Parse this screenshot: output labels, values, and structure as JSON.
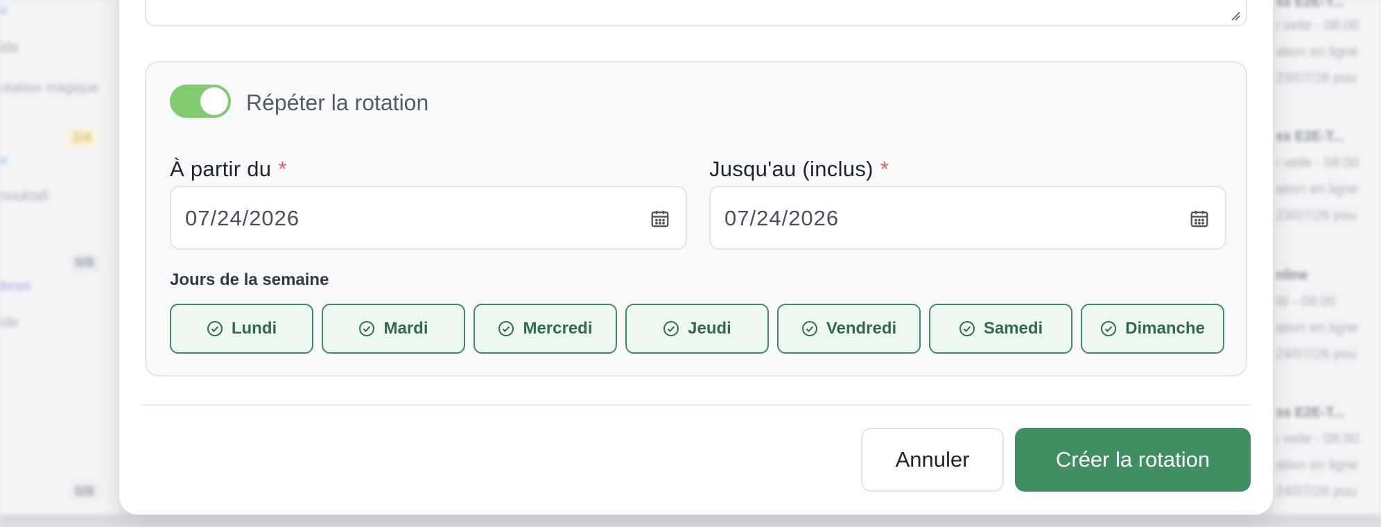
{
  "background": {
    "left_items": [
      {
        "text": "v"
      },
      {
        "text": "ide"
      },
      {
        "text": "otation magique"
      },
      {
        "text": "2/4"
      },
      {
        "text": "v"
      },
      {
        "text": "nouktafi"
      },
      {
        "text": "0/8"
      },
      {
        "text": "bron"
      },
      {
        "text": "ide"
      },
      {
        "text": "0/8"
      }
    ],
    "right_items": [
      {
        "text": "ss E2E-T..."
      },
      {
        "text": "ı veile - 08:00"
      },
      {
        "text": "ation en ligne"
      },
      {
        "text": "23/07/26 pou"
      },
      {
        "text": "ss E2E-T..."
      },
      {
        "text": "ı veile - 08:00"
      },
      {
        "text": "ation en ligne"
      },
      {
        "text": "23/07/26 pou"
      },
      {
        "text": "nline"
      },
      {
        "text": "W - 08:00"
      },
      {
        "text": "ation en ligne"
      },
      {
        "text": "24/07/26 pou"
      },
      {
        "text": "ss E2E-T..."
      },
      {
        "text": "ı veile - 08:00"
      },
      {
        "text": "ation en ligne"
      },
      {
        "text": "24/07/26 pou"
      }
    ]
  },
  "repeat": {
    "enabled": true,
    "label": "Répéter la rotation",
    "from": {
      "label": "À partir du",
      "required_mark": "*",
      "value": "07/24/2026"
    },
    "until": {
      "label": "Jusqu'au (inclus)",
      "required_mark": "*",
      "value": "07/24/2026"
    },
    "days_label": "Jours de la semaine",
    "days": [
      {
        "label": "Lundi",
        "selected": true
      },
      {
        "label": "Mardi",
        "selected": true
      },
      {
        "label": "Mercredi",
        "selected": true
      },
      {
        "label": "Jeudi",
        "selected": true
      },
      {
        "label": "Vendredi",
        "selected": true
      },
      {
        "label": "Samedi",
        "selected": true
      },
      {
        "label": "Dimanche",
        "selected": true
      }
    ]
  },
  "actions": {
    "cancel_label": "Annuler",
    "create_label": "Créer la rotation"
  },
  "icons": {
    "calendar": "calendar-icon",
    "check": "check-circle-icon",
    "resize": "resize-handle-icon"
  },
  "colors": {
    "accent": "#3f8f62",
    "toggle_on": "#7fcb6e",
    "chip_bg": "#edf8f0",
    "required": "#e2634f"
  }
}
